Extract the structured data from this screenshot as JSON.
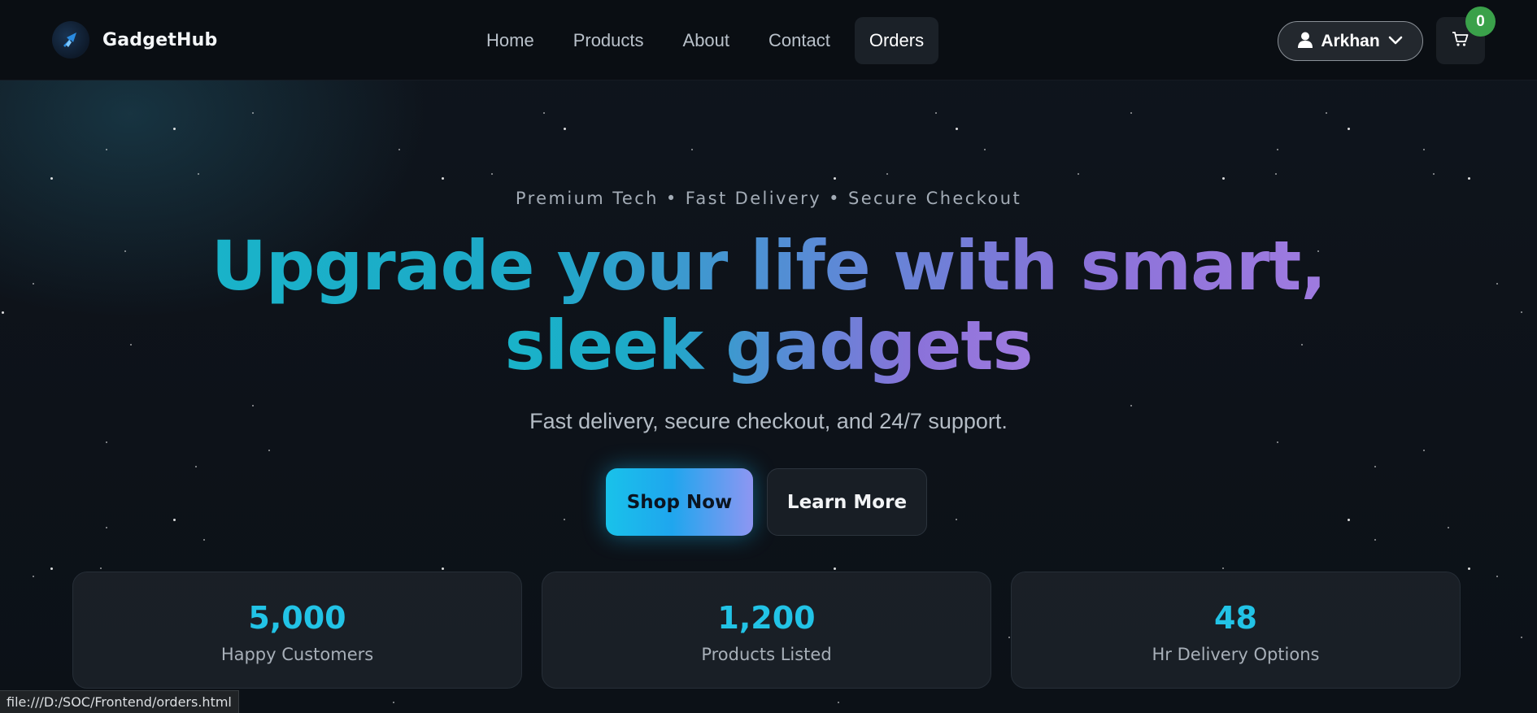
{
  "brand": {
    "name": "GadgetHub",
    "logo_icon": "rocket-logo-icon"
  },
  "nav": {
    "links": [
      {
        "label": "Home",
        "active": false
      },
      {
        "label": "Products",
        "active": false
      },
      {
        "label": "About",
        "active": false
      },
      {
        "label": "Contact",
        "active": false
      },
      {
        "label": "Orders",
        "active": true
      }
    ]
  },
  "user_menu": {
    "name": "Arkhan",
    "icon": "user-icon",
    "chevron": "chevron-down-icon"
  },
  "cart": {
    "icon": "cart-icon",
    "count": "0"
  },
  "hero": {
    "tagline": "Premium Tech • Fast Delivery • Secure Checkout",
    "headline_line1": "Upgrade your life with smart,",
    "headline_line2": "sleek gadgets",
    "subheadline": "Fast delivery, secure checkout, and 24/7 support.",
    "primary_cta": "Shop Now",
    "secondary_cta": "Learn More"
  },
  "stats": [
    {
      "value": "5,000",
      "label": "Happy Customers"
    },
    {
      "value": "1,200",
      "label": "Products Listed"
    },
    {
      "value": "48",
      "label": "Hr Delivery Options"
    }
  ],
  "status_bar": {
    "url": "file:///D:/SOC/Frontend/orders.html"
  },
  "colors": {
    "background": "#0d1117",
    "navbar": "#0a0e13",
    "accent_cyan": "#22c3e6",
    "accent_purple": "#9f7be0",
    "badge_green": "#3aa14a"
  }
}
